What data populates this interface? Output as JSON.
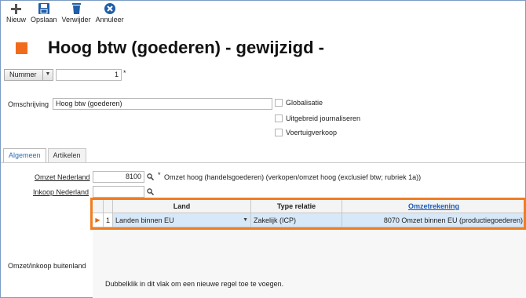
{
  "toolbar": {
    "new_label": "Nieuw",
    "save_label": "Opslaan",
    "delete_label": "Verwijder",
    "cancel_label": "Annuleer",
    "new_icon": "plus-icon",
    "save_icon": "save-icon",
    "delete_icon": "delete-icon",
    "cancel_icon": "cancel-icon"
  },
  "header": {
    "title": "Hoog btw (goederen) - gewijzigd -",
    "accent_color": "#f26b1d"
  },
  "nummer": {
    "label": "Nummer",
    "value": "1",
    "required": "*"
  },
  "omschrijving": {
    "label": "Omschrijving",
    "value": "Hoog btw (goederen)"
  },
  "checkboxes": [
    {
      "label": "Globalisatie",
      "checked": false
    },
    {
      "label": "Uitgebreid journaliseren",
      "checked": false
    },
    {
      "label": "Voertuigverkoop",
      "checked": false
    }
  ],
  "tabs": [
    {
      "label": "Algemeen",
      "active": true
    },
    {
      "label": "Artikelen",
      "active": false
    }
  ],
  "algemeen": {
    "omzet_nederland_label": "Omzet Nederland",
    "omzet_nederland_value": "8100",
    "omzet_required": "*",
    "omzet_description": "Omzet hoog (handelsgoederen) (verkopen/omzet hoog (exclusief btw; rubriek 1a))",
    "inkoop_nederland_label": "Inkoop Nederland",
    "inkoop_nederland_value": "",
    "buitenland_label": "Omzet/inkoop buitenland"
  },
  "grid": {
    "columns": [
      "Land",
      "Type relatie",
      "Omzetrekening"
    ],
    "rows": [
      {
        "num": "1",
        "land": "Landen binnen EU",
        "type": "Zakelijk (ICP)",
        "omzet": "8070 Omzet binnen EU (productiegoederen)"
      }
    ],
    "hint": "Dubbelklik in dit vlak om een nieuwe regel toe te voegen.",
    "highlight_color": "#f07d22",
    "selected_row_color": "#d7e8f8"
  }
}
